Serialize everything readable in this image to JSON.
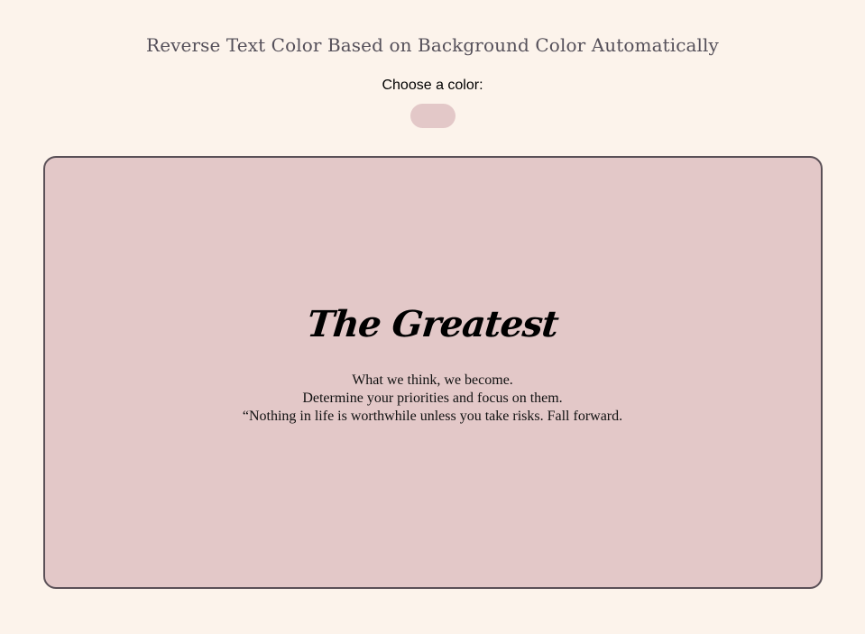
{
  "header": {
    "title": "Reverse Text Color Based on Background Color Automatically"
  },
  "color_picker": {
    "label": "Choose a color:",
    "selected_color": "#e3c8c8"
  },
  "card": {
    "background": "#e3c8c8",
    "title": "The Greatest",
    "lines": [
      "What we think, we become.",
      "Determine your priorities and focus on them.",
      "“Nothing in life is worthwhile unless you take risks. Fall forward."
    ]
  },
  "colors": {
    "page_background": "#fcf3eb",
    "card_border": "#5a5057",
    "text": "#000000"
  }
}
